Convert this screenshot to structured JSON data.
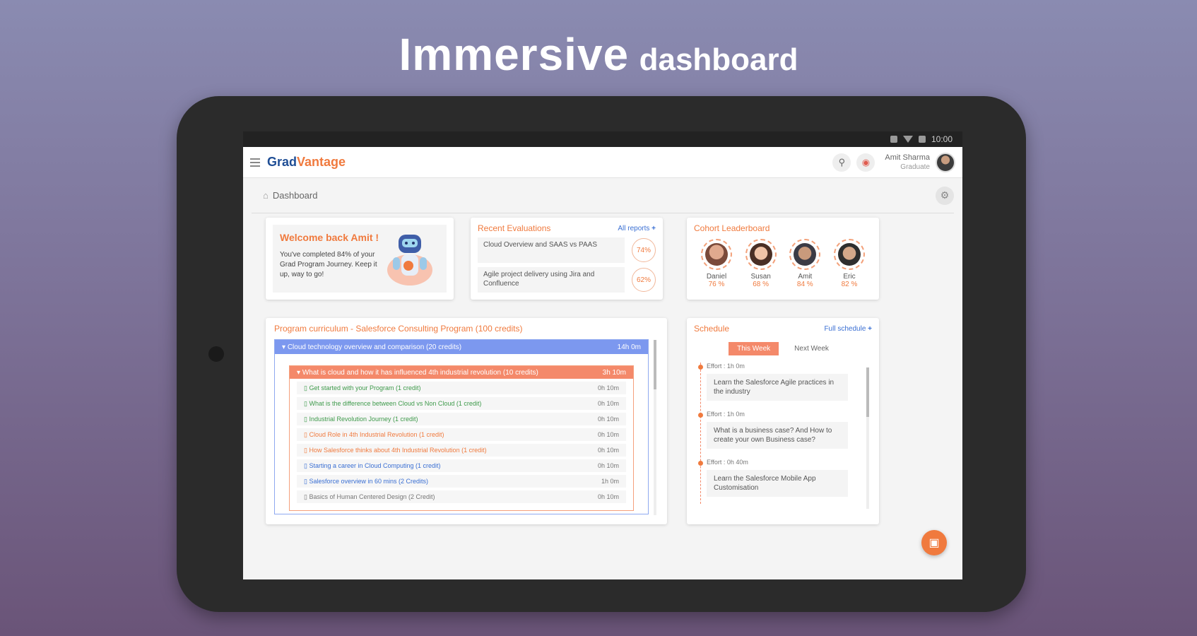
{
  "headline": {
    "big": "Immersive",
    "small": "dashboard"
  },
  "statusbar": {
    "time": "10:00"
  },
  "appbar": {
    "logo_part1": "Grad",
    "logo_part2": "Vantage",
    "user_name": "Amit Sharma",
    "user_role": "Graduate"
  },
  "breadcrumb": {
    "label": "Dashboard"
  },
  "welcome": {
    "title": "Welcome back Amit !",
    "text": "You've completed 84% of your Grad Program Journey. Keep it up, way to go!"
  },
  "evaluations": {
    "title": "Recent Evaluations",
    "link": "All reports",
    "items": [
      {
        "text": "Cloud Overview and SAAS vs PAAS",
        "score": "74%"
      },
      {
        "text": "Agile project delivery using Jira and Confluence",
        "score": "62%"
      }
    ]
  },
  "leaderboard": {
    "title": "Cohort Leaderboard",
    "people": [
      {
        "name": "Daniel",
        "pct": "76 %"
      },
      {
        "name": "Susan",
        "pct": "68 %"
      },
      {
        "name": "Amit",
        "pct": "84 %"
      },
      {
        "name": "Eric",
        "pct": "82 %"
      }
    ]
  },
  "curriculum": {
    "title": "Program curriculum - Salesforce Consulting Program (100 credits)",
    "module": {
      "title": "Cloud technology overview and comparison (20 credits)",
      "duration": "14h 0m"
    },
    "submodule": {
      "title": "What is cloud and how it has influenced 4th industrial revolution (10 credits)",
      "duration": "3h 10m"
    },
    "lessons": [
      {
        "title": "Get started with your Program (1 credit)",
        "duration": "0h 10m",
        "color": "green"
      },
      {
        "title": "What is the difference between Cloud vs Non Cloud (1 credit)",
        "duration": "0h 10m",
        "color": "green"
      },
      {
        "title": "Industrial Revolution Journey (1 credit)",
        "duration": "0h 10m",
        "color": "green"
      },
      {
        "title": "Cloud Role in 4th Industrial Revolution (1 credit)",
        "duration": "0h 10m",
        "color": "orange"
      },
      {
        "title": "How Salesforce thinks about 4th Industrial Revolution (1 credit)",
        "duration": "0h 10m",
        "color": "orange"
      },
      {
        "title": "Starting a career in Cloud Computing (1 credit)",
        "duration": "0h 10m",
        "color": "blue"
      },
      {
        "title": "Salesforce overview in 60 mins (2 Credits)",
        "duration": "1h 0m",
        "color": "blue"
      },
      {
        "title": "Basics of Human Centered Design (2 Credit)",
        "duration": "0h 10m",
        "color": "grey"
      }
    ]
  },
  "schedule": {
    "title": "Schedule",
    "link": "Full schedule",
    "tabs": [
      "This Week",
      "Next Week"
    ],
    "events": [
      {
        "effort": "Effort : 1h 0m",
        "text": "Learn the Salesforce Agile practices in the industry"
      },
      {
        "effort": "Effort : 1h 0m",
        "text": "What is a business case? And How to create your own Business case?"
      },
      {
        "effort": "Effort : 0h 40m",
        "text": "Learn the Salesforce Mobile App Customisation"
      }
    ]
  }
}
